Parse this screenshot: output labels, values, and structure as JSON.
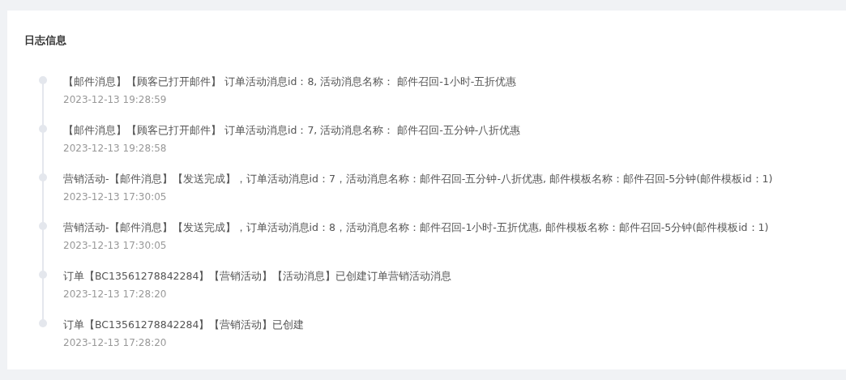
{
  "panel": {
    "title": "日志信息"
  },
  "log_entries": [
    {
      "message": "【邮件消息】【顾客已打开邮件】 订单活动消息id：8, 活动消息名称： 邮件召回-1小时-五折优惠",
      "time": "2023-12-13 19:28:59"
    },
    {
      "message": "【邮件消息】【顾客已打开邮件】 订单活动消息id：7, 活动消息名称： 邮件召回-五分钟-八折优惠",
      "time": "2023-12-13 19:28:58"
    },
    {
      "message": "营销活动-【邮件消息】【发送完成】，订单活动消息id：7，活动消息名称：邮件召回-五分钟-八折优惠, 邮件模板名称：邮件召回-5分钟(邮件模板id：1)",
      "time": "2023-12-13 17:30:05"
    },
    {
      "message": "营销活动-【邮件消息】【发送完成】，订单活动消息id：8，活动消息名称：邮件召回-1小时-五折优惠, 邮件模板名称：邮件召回-5分钟(邮件模板id：1)",
      "time": "2023-12-13 17:30:05"
    },
    {
      "message": "订单【BC13561278842284】【营销活动】【活动消息】已创建订单营销活动消息",
      "time": "2023-12-13 17:28:20"
    },
    {
      "message": "订单【BC13561278842284】【营销活动】已创建",
      "time": "2023-12-13 17:28:20"
    }
  ]
}
